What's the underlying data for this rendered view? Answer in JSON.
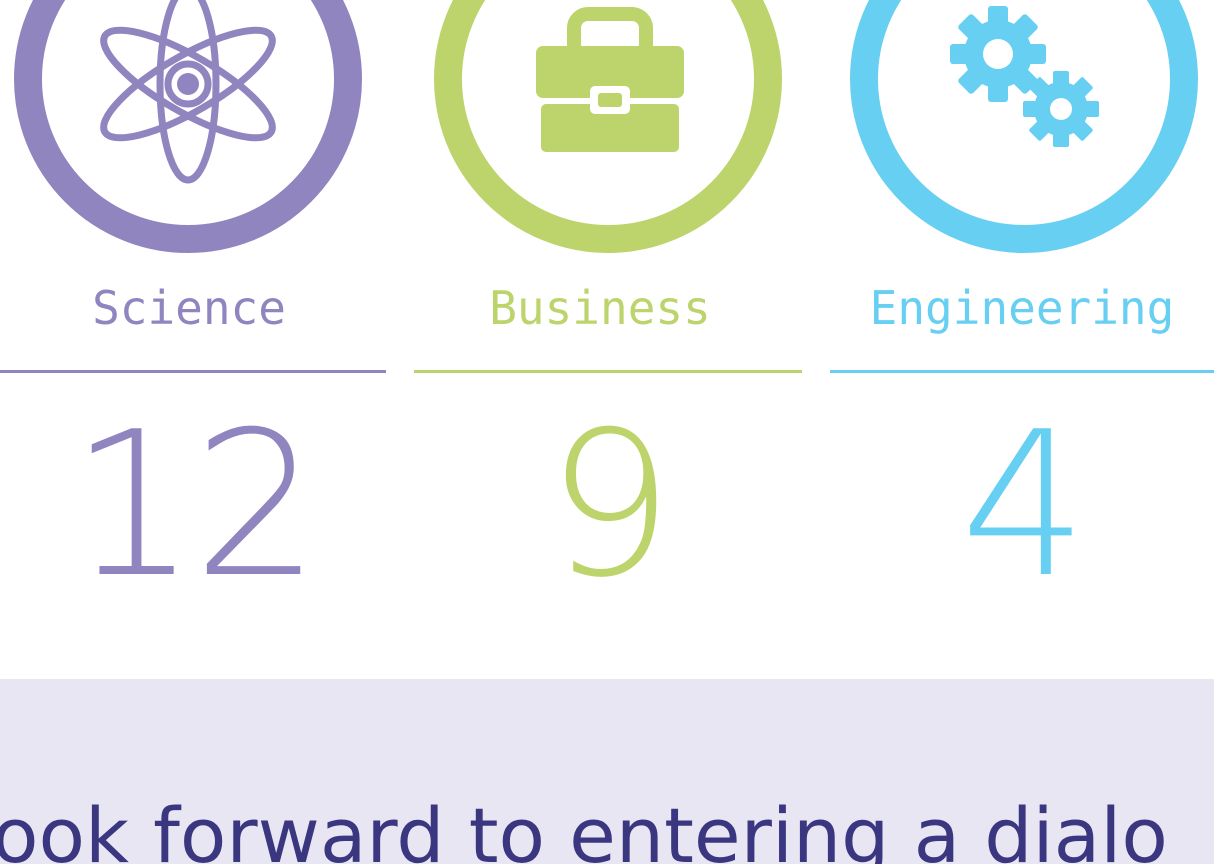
{
  "colors": {
    "science": "#9185c0",
    "business": "#bcd46b",
    "engineering": "#67cff2",
    "quote_band": "#e8e6f2",
    "quote_text": "#3b3680"
  },
  "stats": [
    {
      "icon": "atom-icon",
      "label": "Science",
      "count": "12"
    },
    {
      "icon": "briefcase-icon",
      "label": "Business",
      "count": "9"
    },
    {
      "icon": "gears-icon",
      "label": "Engineering",
      "count": "4"
    }
  ],
  "quote": {
    "text": "ook forward to entering a dialo"
  }
}
